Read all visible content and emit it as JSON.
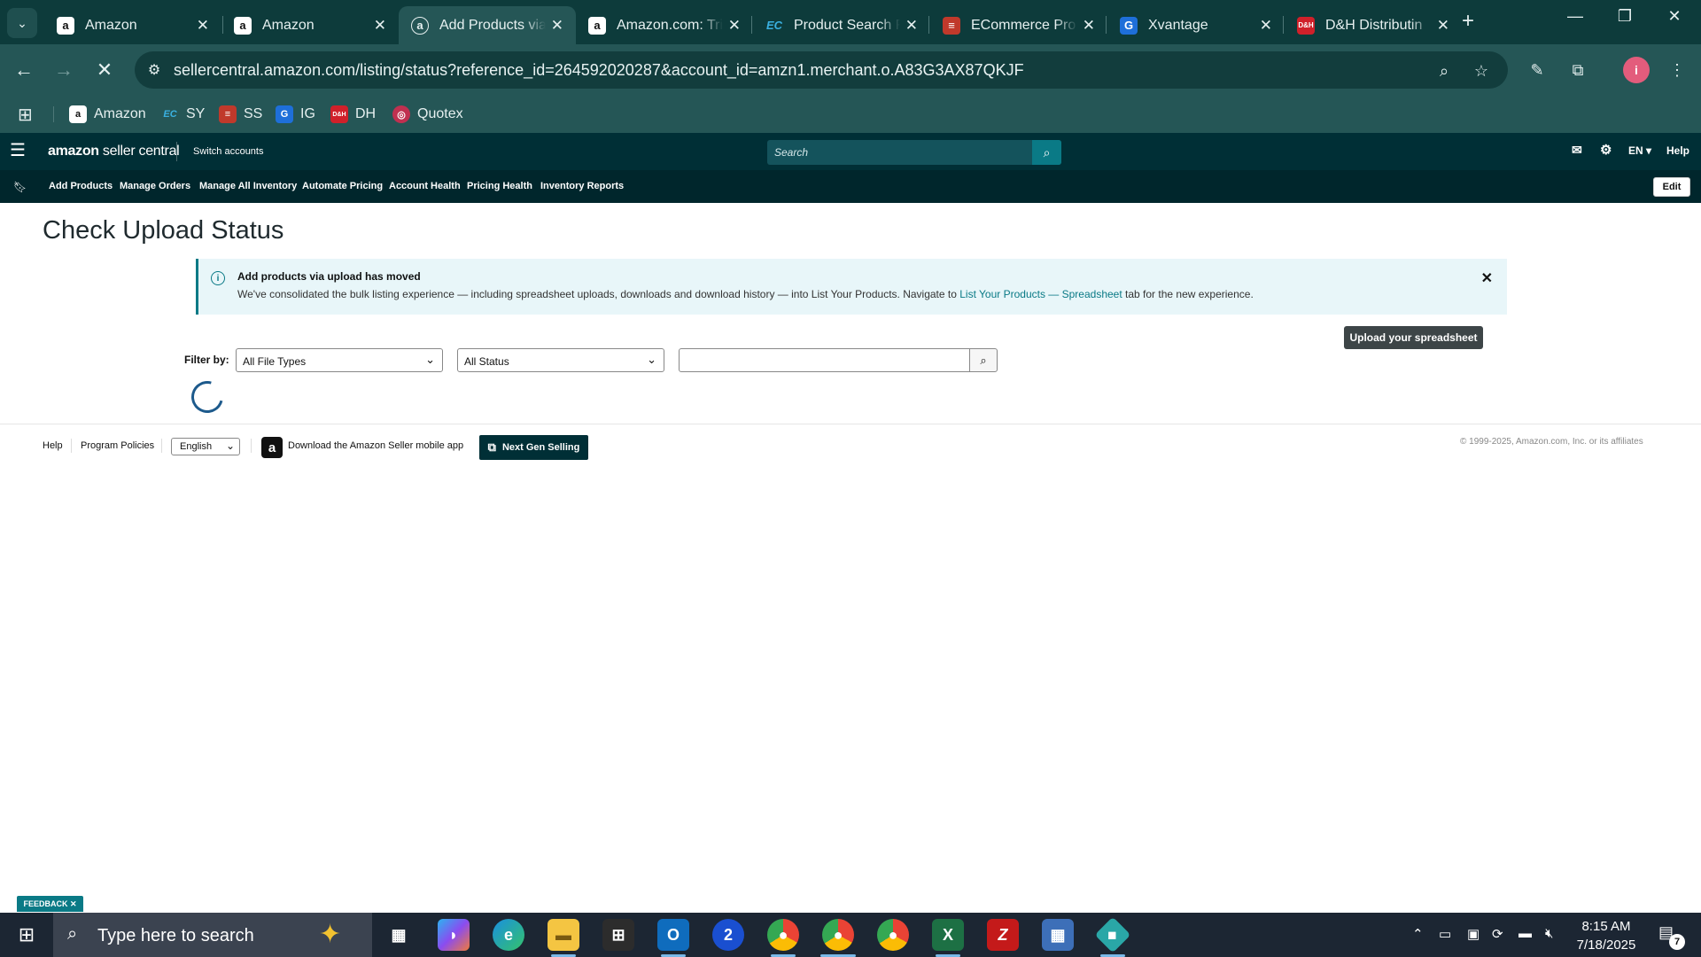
{
  "browser": {
    "tabs": [
      {
        "title": "Amazon",
        "favicon": "amazon-icon"
      },
      {
        "title": "Amazon",
        "favicon": "amazon-icon"
      },
      {
        "title": "Add Products via Upload",
        "favicon": "amazon-outline-icon",
        "active": true
      },
      {
        "title": "Amazon.com: Tri",
        "favicon": "amazon-icon"
      },
      {
        "title": "Product Search R",
        "favicon": "ec-icon"
      },
      {
        "title": "ECommerce Pro",
        "favicon": "ecommerce-icon"
      },
      {
        "title": "Xvantage",
        "favicon": "xvantage-icon"
      },
      {
        "title": "D&H Distributin",
        "favicon": "dh-icon"
      }
    ],
    "url": "sellercentral.amazon.com/listing/status?reference_id=264592020287&account_id=amzn1.merchant.o.A83G3AX87QKJF",
    "bookmarks": [
      {
        "label": "Amazon"
      },
      {
        "label": "SY"
      },
      {
        "label": "SS"
      },
      {
        "label": "IG"
      },
      {
        "label": "DH"
      },
      {
        "label": "Quotex"
      }
    ]
  },
  "seller_central": {
    "logo_bold": "amazon",
    "logo_rest": " seller central",
    "switch_accounts": "Switch accounts",
    "search_placeholder": "Search",
    "language": "EN",
    "help": "Help",
    "nav": [
      "Add Products",
      "Manage Orders",
      "Manage All Inventory",
      "Automate Pricing",
      "Account Health",
      "Pricing Health",
      "Inventory Reports"
    ],
    "edit": "Edit"
  },
  "main": {
    "title": "Check Upload Status",
    "alert": {
      "heading": "Add products via upload has moved",
      "body_prefix": "We've consolidated the bulk listing experience — including spreadsheet uploads, downloads and download history — into List Your Products. Navigate to ",
      "link_text": "List Your Products — Spreadsheet",
      "body_suffix": " tab for the new experience."
    },
    "upload_button": "Upload your spreadsheet",
    "filter_label": "Filter by:",
    "file_type_selected": "All File Types",
    "status_selected": "All Status",
    "search_value": ""
  },
  "footer": {
    "help": "Help",
    "program_policies": "Program Policies",
    "language": "English",
    "app_text": "Download the Amazon Seller mobile app",
    "next_gen": "Next Gen Selling",
    "copyright": "© 1999-2025, Amazon.com, Inc. or its affiliates"
  },
  "feedback": "FEEDBACK",
  "taskbar": {
    "search_placeholder": "Type here to search",
    "time": "8:15 AM",
    "date": "7/18/2025",
    "notification_count": "7"
  },
  "colors": {
    "chrome_frame": "#0d3b3b",
    "chrome_toolbar": "#255656",
    "sc_header": "#002f36",
    "sc_nav": "#00262c",
    "accent": "#0a7a86"
  }
}
